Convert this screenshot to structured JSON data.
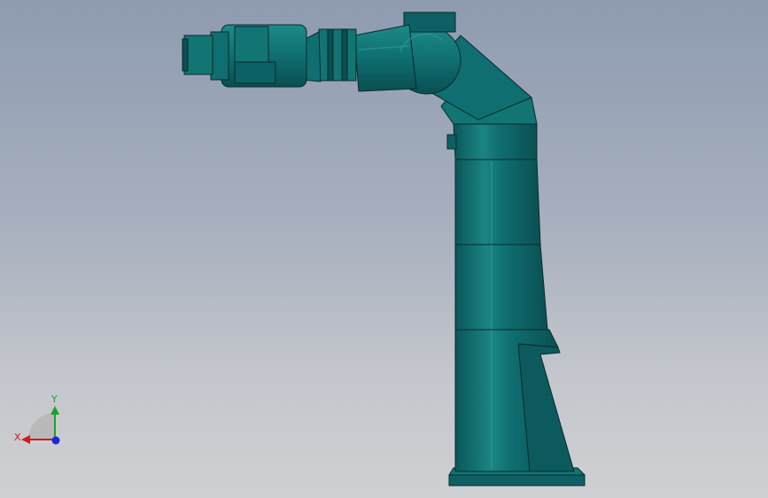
{
  "view": {
    "background_top": "#8e9bb0",
    "background_bottom": "#cfd0d3",
    "model_color": "#0f6e70",
    "model_shadow": "#0a4f52",
    "model_highlight": "#2d9a97",
    "edge_color": "#0a2a2b"
  },
  "triad": {
    "x_label": "X",
    "y_label": "Y",
    "x_color": "#d21a1a",
    "y_color": "#17a52c",
    "z_color": "#1a2ad2"
  }
}
